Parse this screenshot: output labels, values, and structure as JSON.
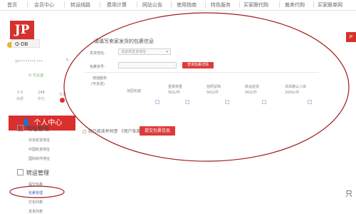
{
  "nav": {
    "items": [
      "首页",
      "会员中心",
      "转运线路",
      "费用计算",
      "网站公告",
      "使用指南",
      "特色服务",
      "买家跟代购",
      "裁卖代购",
      "买家跟单网"
    ]
  },
  "sidebar": {
    "logo_text": "JP",
    "logo_badge": "Q-DB",
    "user_line": "Ja••• (•••) •••",
    "cert_label": "已认证",
    "stats": [
      {
        "value": "1 0",
        "label": "余额"
      },
      {
        "value": "148",
        "label": "积分"
      },
      {
        "value": "",
        "label": "优惠"
      }
    ],
    "center_label": "个人中心",
    "section1": {
      "title": "地址管理",
      "links": [
        "日本收货地址",
        "中国收货地址",
        "国际收件地址"
      ]
    },
    "section2": {
      "title": "转运管理",
      "links": [
        "提交包裹",
        "包裹管理",
        "打包列表",
        "发货列表"
      ]
    }
  },
  "main": {
    "panel_title": "请填写卖家发货的包裹信息",
    "field1_label": "发货地址:",
    "field1_value": "请选择发货地址",
    "field2_label": "包裹单号:",
    "field2_value": "",
    "query_button": "查询包裹详情",
    "service_label": "增值服务",
    "service_note": "(可多选)",
    "columns": [
      {
        "title": "加固包装",
        "price": ""
      },
      {
        "title": "重量称重",
        "price": "5KG/件"
      },
      {
        "title": "拍照留档",
        "price": "5KG/件"
      },
      {
        "title": "转运验货",
        "price": "5KG/件"
      },
      {
        "title": "清单确认入库",
        "price": "20KG/件"
      }
    ],
    "agree_text": "□ 我已阅读并同意 《用户条款》",
    "submit_button": "提交包裹信息",
    "right_badge": "JP"
  },
  "watermark": "只",
  "colors": {
    "accent": "#d92f2d",
    "annotation": "#a11b1b",
    "link": "#3a6ac7"
  }
}
